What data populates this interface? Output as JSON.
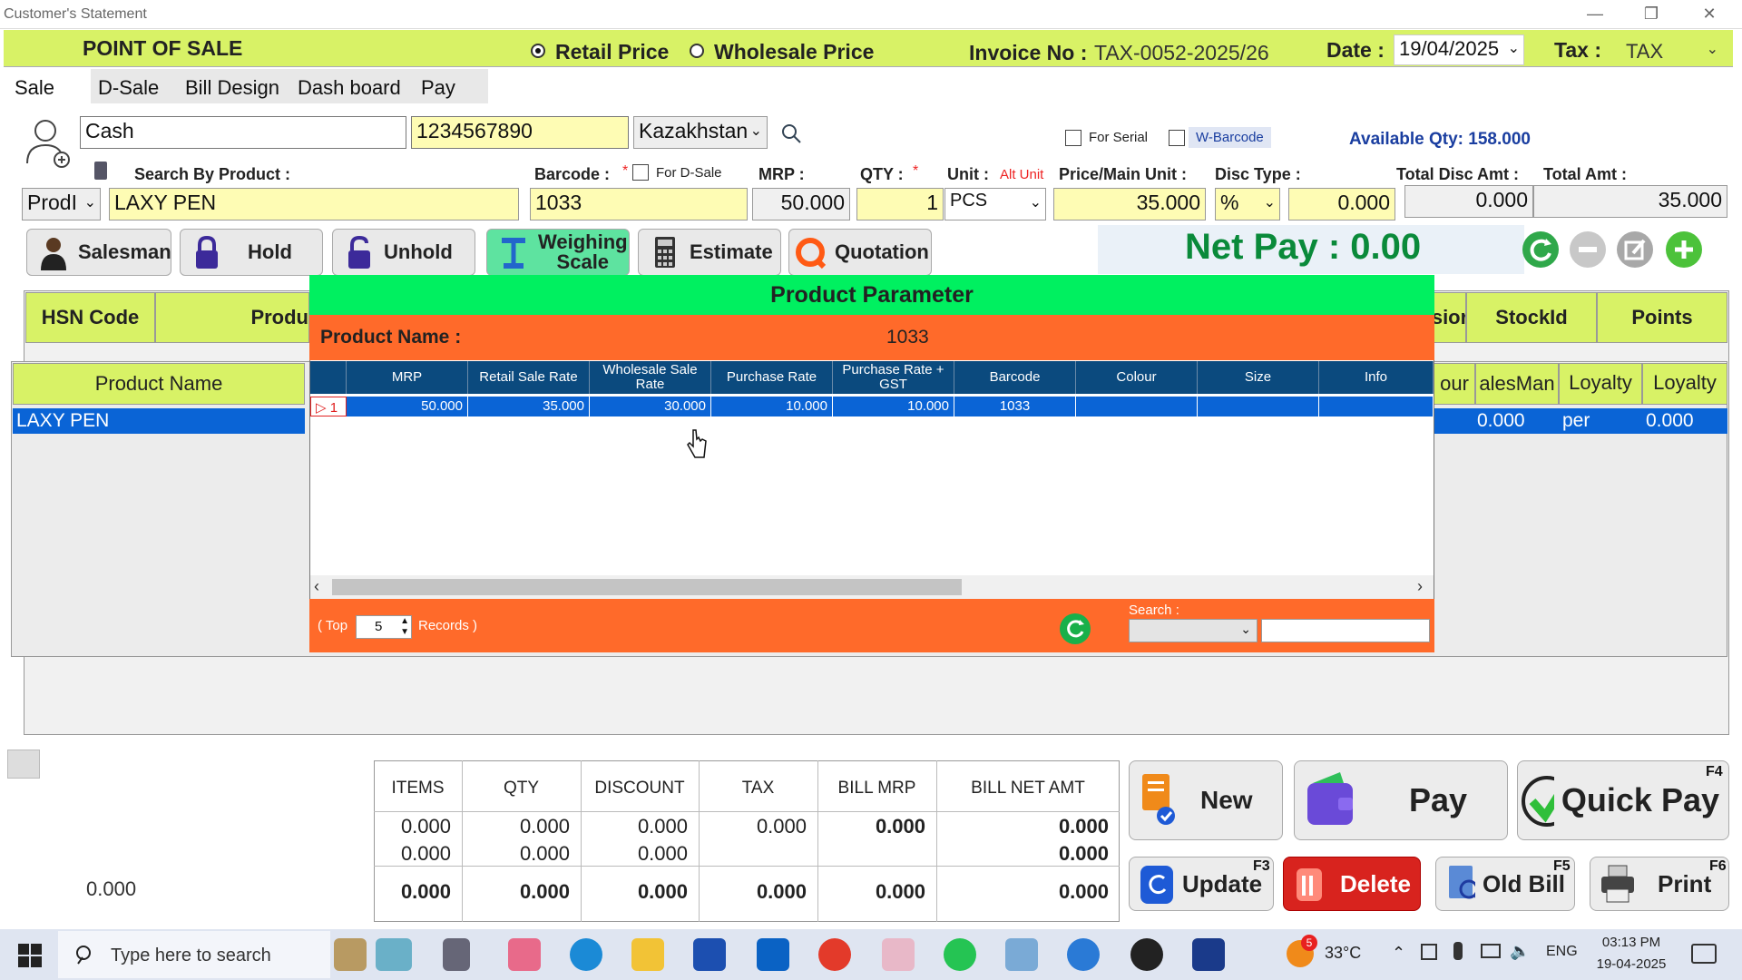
{
  "window": {
    "title": "Customer's Statement",
    "minimize": "—",
    "restore": "❐",
    "close": "✕"
  },
  "topbar": {
    "title": "POINT OF SALE",
    "retail_label": "Retail Price",
    "wholesale_label": "Wholesale Price",
    "invoice_label": "Invoice No :",
    "invoice_value": "TAX-0052-2025/26",
    "date_label": "Date :",
    "date_value": "19/04/2025",
    "tax_label": "Tax :",
    "tax_value": "TAX"
  },
  "tabs": [
    "Sale",
    "D-Sale",
    "Bill Design",
    "Dash board",
    "Pay"
  ],
  "customer": {
    "name": "Cash",
    "phone": "1234567890",
    "country": "Kazakhstan",
    "for_serial": "For Serial",
    "w_barcode": "W-Barcode",
    "available_qty": "Available Qty: 158.000"
  },
  "entry": {
    "search_label": "Search By Product :",
    "search_mode": "ProdІ",
    "product": "LAXY PEN",
    "barcode_label": "Barcode :",
    "required_mark": "*",
    "for_dsale": "For D-Sale",
    "barcode": "1033",
    "mrp_label": "MRP :",
    "mrp": "50.000",
    "qty_label": "QTY :",
    "qty": "1",
    "unit_label": "Unit :",
    "alt_unit": "Alt Unit",
    "unit": "PCS",
    "price_label": "Price/Main Unit :",
    "price": "35.000",
    "disc_type_label": "Disc Type :",
    "disc_type": "%",
    "disc_value": "0.000",
    "total_disc_label": "Total Disc Amt :",
    "total_disc": "0.000",
    "total_amt_label": "Total Amt :",
    "total_amt": "35.000"
  },
  "buttons": {
    "salesman": "Salesman",
    "hold": "Hold",
    "unhold": "Unhold",
    "weighing1": "Weighing",
    "weighing2": "Scale",
    "estimate": "Estimate",
    "quotation": "Quotation"
  },
  "netpay": "Net Pay : 0.00",
  "grid": {
    "headers": [
      "HSN Code",
      "Produ",
      "sior",
      "StockId",
      "Points"
    ],
    "sub_headers": [
      "Product Name",
      "our",
      "alesMan",
      "Loyalty",
      "Loyalty"
    ],
    "row": [
      "LAXY PEN",
      "0.000",
      "per",
      "0.000"
    ]
  },
  "modal": {
    "title": "Product Parameter",
    "name_label": "Product Name :",
    "name_value": "1033",
    "columns": [
      "MRP",
      "Retail Sale Rate",
      "Wholesale Sale Rate",
      "Purchase Rate",
      "Purchase Rate + GST",
      "Barcode",
      "Colour",
      "Size",
      "Info"
    ],
    "row_marker": "▷ 1",
    "row": [
      "50.000",
      "35.000",
      "30.000",
      "10.000",
      "10.000",
      "1033",
      "",
      "",
      ""
    ],
    "top_label": "( Top",
    "top_value": "5",
    "records_label": "Records )",
    "search_label": "Search :"
  },
  "summary": {
    "headers": [
      "ITEMS",
      "QTY",
      "DISCOUNT",
      "TAX",
      "BILL MRP",
      "BILL NET AMT"
    ],
    "row1": [
      "0.000",
      "0.000",
      "0.000",
      "0.000",
      "0.000",
      "0.000"
    ],
    "row2": [
      "0.000",
      "0.000",
      "0.000",
      "",
      "",
      "0.000"
    ],
    "row3": [
      "0.000",
      "0.000",
      "0.000",
      "0.000",
      "0.000",
      "0.000"
    ],
    "left_total": "0.000"
  },
  "actions": {
    "new": "New",
    "pay": "Pay",
    "quick_pay": "Quick Pay",
    "quick_pay_key": "F4",
    "update": "Update",
    "update_key": "F3",
    "delete": "Delete",
    "old_bill": "Old Bill",
    "old_bill_key": "F5",
    "print": "Print",
    "print_key": "F6"
  },
  "taskbar": {
    "search_placeholder": "Type here to search",
    "temp": "33°C",
    "weather_badge": "5",
    "lang": "ENG",
    "time": "03:13 PM",
    "date": "19-04-2025"
  },
  "colors": {
    "lime": "#d8f266",
    "orange": "#ff6a2a",
    "green": "#00f060",
    "navy": "#0b4a7e",
    "blue": "#0a64d6"
  }
}
